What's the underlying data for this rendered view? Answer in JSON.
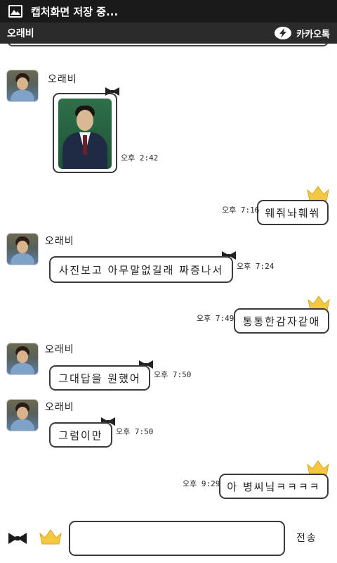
{
  "status_bar": {
    "text": "캡처화면 저장 중...",
    "icon": "image-icon"
  },
  "header": {
    "title": "오래비",
    "brand": "카카오톡",
    "brand_icon": "kakao-lightning-icon"
  },
  "messages": [
    {
      "type": "image",
      "sender": "오래비",
      "time": "오후 2:42",
      "image": "profile-photo"
    },
    {
      "type": "sent",
      "text": "웨줘놔훼쒀",
      "time": "오후 7:16"
    },
    {
      "type": "received",
      "sender": "오래비",
      "text": "사진보고 아무말없길래 짜증나서",
      "time": "오후 7:24"
    },
    {
      "type": "sent",
      "text": "통통한감자같애",
      "time": "오후 7:49"
    },
    {
      "type": "received",
      "sender": "오래비",
      "text": "그대답을 원했어",
      "time": "오후 7:50"
    },
    {
      "type": "received",
      "sender": "오래비",
      "text": "그럼이만",
      "time": "오후 7:50"
    },
    {
      "type": "sent",
      "text": "아 병씨닠ㅋㅋㅋㅋ",
      "time": "오후 9:29"
    }
  ],
  "input": {
    "placeholder": "",
    "send_label": "전송",
    "left_icons": [
      "bow-icon",
      "crown-icon"
    ]
  },
  "colors": {
    "status_bar": "#1a1a1a",
    "header": "#2b2b2b",
    "bubble_border": "#3a3a3a",
    "crown": "#f5c842"
  }
}
